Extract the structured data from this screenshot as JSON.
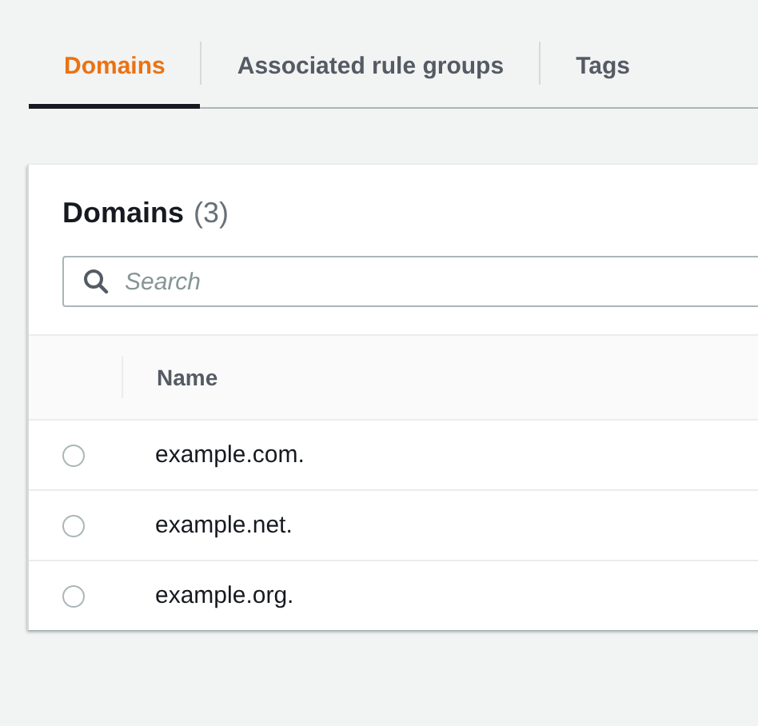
{
  "tabs": [
    {
      "label": "Domains",
      "selected": true
    },
    {
      "label": "Associated rule groups",
      "selected": false
    },
    {
      "label": "Tags",
      "selected": false
    }
  ],
  "panel": {
    "title": "Domains",
    "count": "(3)",
    "search": {
      "placeholder": "Search"
    },
    "table": {
      "columns": [
        "Name"
      ],
      "rows": [
        {
          "name": "example.com.",
          "selected": false
        },
        {
          "name": "example.net.",
          "selected": false
        },
        {
          "name": "example.org.",
          "selected": false
        }
      ]
    }
  }
}
